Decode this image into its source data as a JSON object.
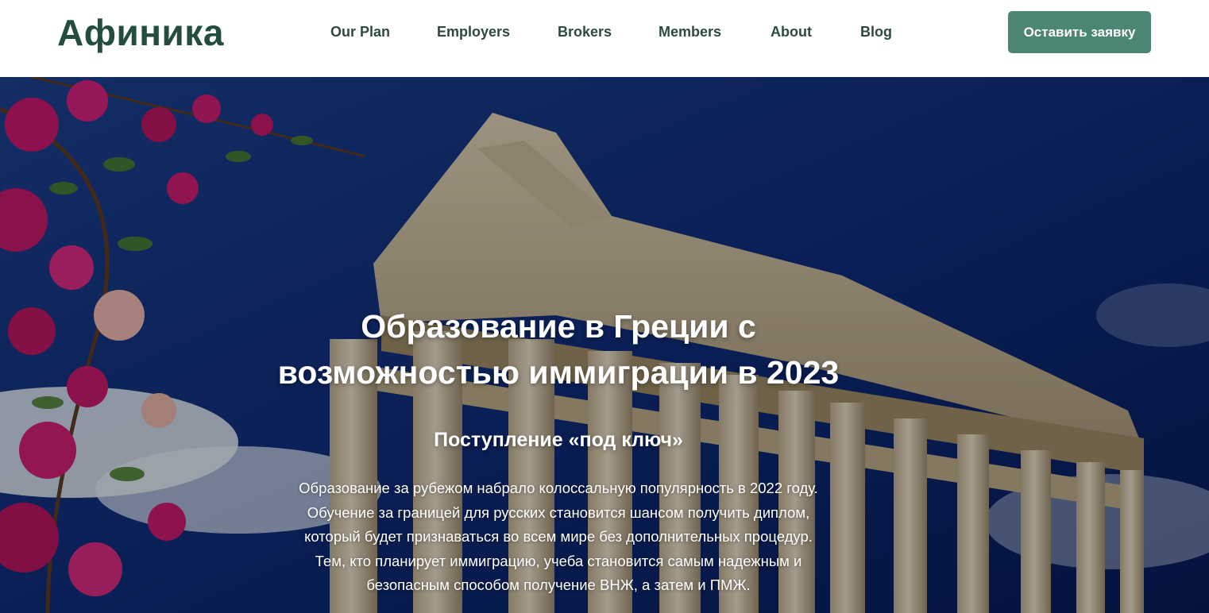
{
  "header": {
    "logo": "Афиника",
    "nav": [
      {
        "label": "Our Plan"
      },
      {
        "label": "Employers"
      },
      {
        "label": "Brokers"
      },
      {
        "label": "Members"
      },
      {
        "label": "About"
      },
      {
        "label": "Blog"
      }
    ],
    "cta_label": "Оставить заявку"
  },
  "hero": {
    "title_line1": "Образование в Греции с",
    "title_line2": "возможностью иммиграции в 2023",
    "subtitle": "Поступление «под ключ»",
    "paragraph_lines": [
      "Образование за рубежом набрало колоссальную популярность в 2022 году.",
      "Обучение за границей для русских становится шансом получить диплом,",
      "который будет признаваться во всем мире без дополнительных процедур.",
      "Тем, кто планирует иммиграцию, учеба становится самым надежным и",
      "безопасным способом получение ВНЖ, а затем и ПМЖ."
    ],
    "background_image": "parthenon-with-bougainvillea"
  },
  "colors": {
    "brand_dark_green": "#234d3c",
    "nav_text": "#2c4a3d",
    "cta_background": "#4b8670",
    "cta_text": "#ffffff",
    "sky": "#0a1a52"
  }
}
